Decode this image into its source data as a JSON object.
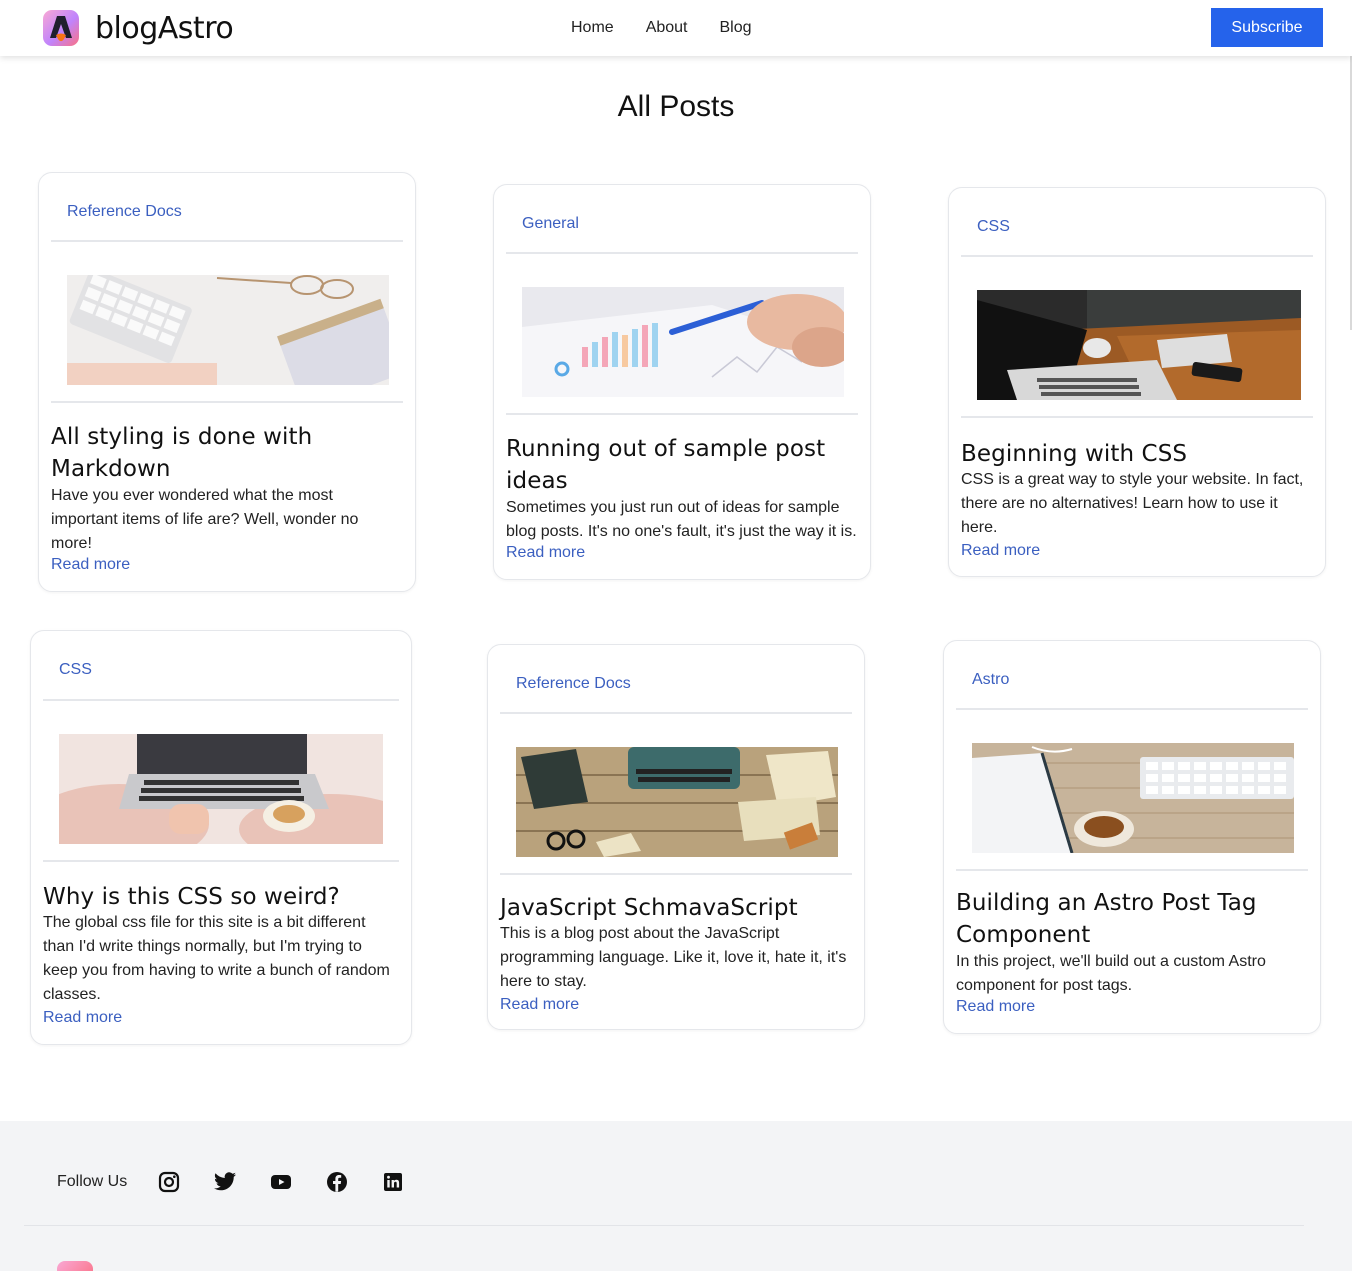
{
  "header": {
    "brand": "blogAstro",
    "nav": [
      "Home",
      "About",
      "Blog"
    ],
    "subscribe_label": "Subscribe"
  },
  "main": {
    "title": "All Posts",
    "posts": [
      {
        "tag": "Reference Docs",
        "image_icon": "keyboard-glasses-photo",
        "title": "All styling is done with Markdown",
        "excerpt": "Have you ever wondered what the most important items of life are? Well, wonder no more!",
        "more": "Read more"
      },
      {
        "tag": "General",
        "image_icon": "chart-pen-photo",
        "title": "Running out of sample post ideas",
        "excerpt": "Sometimes you just run out of ideas for sample blog posts. It's no one's fault, it's just the way it is.",
        "more": "Read more"
      },
      {
        "tag": "CSS",
        "image_icon": "laptop-desk-photo",
        "title": "Beginning with CSS",
        "excerpt": "CSS is a great way to style your website. In fact, there are no alternatives! Learn how to use it here.",
        "more": "Read more"
      },
      {
        "tag": "CSS",
        "image_icon": "laptop-lap-photo",
        "title": "Why is this CSS so weird?",
        "excerpt": "The global css file for this site is a bit different than I'd write things normally, but I'm trying to keep you from having to write a bunch of random classes.",
        "more": "Read more"
      },
      {
        "tag": "Reference Docs",
        "image_icon": "typewriter-photo",
        "title": "JavaScript SchmavaScript",
        "excerpt": "This is a blog post about the JavaScript programming language. Like it, love it, hate it, it's here to stay.",
        "more": "Read more"
      },
      {
        "tag": "Astro",
        "image_icon": "notebook-coffee-photo",
        "title": "Building an Astro Post Tag Component",
        "excerpt": "In this project, we'll build out a custom Astro component for post tags.",
        "more": "Read more"
      }
    ]
  },
  "footer": {
    "follow_label": "Follow Us",
    "social_icons": [
      "instagram-icon",
      "twitter-icon",
      "youtube-icon",
      "facebook-icon",
      "linkedin-icon"
    ]
  },
  "colors": {
    "accent": "#2563eb",
    "link": "#3b5fc0",
    "footer_bg": "#f3f4f6"
  }
}
